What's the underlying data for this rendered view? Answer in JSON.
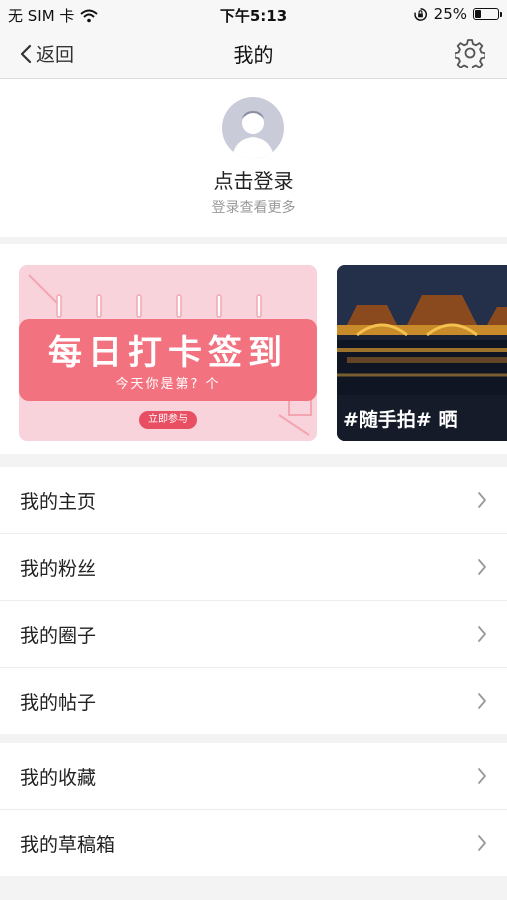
{
  "status_bar": {
    "carrier": "无 SIM 卡",
    "time": "下午5:13",
    "battery_percent": "25%",
    "battery_level": 0.25
  },
  "nav": {
    "back_label": "返回",
    "title": "我的"
  },
  "profile": {
    "login_title": "点击登录",
    "login_subtitle": "登录查看更多"
  },
  "banners": {
    "checkin": {
      "title": "每日打卡签到",
      "subtitle": "今天你是第? 个",
      "button": "立即参与"
    },
    "photo": {
      "caption": "#随手拍# 晒"
    }
  },
  "list_group_1": [
    "我的主页",
    "我的粉丝",
    "我的圈子",
    "我的帖子"
  ],
  "list_group_2": [
    "我的收藏",
    "我的草稿箱"
  ],
  "colors": {
    "checkin_bg": "#f9d3dc",
    "checkin_ribbon": "#f3727f",
    "checkin_button": "#e84f63",
    "avatar_bg": "#c9cbd8"
  },
  "icons": {
    "back": "chevron-left-icon",
    "settings": "gear-icon",
    "wifi": "wifi-icon",
    "rotation_lock": "rotation-lock-icon",
    "battery": "battery-icon",
    "chevron": "chevron-right-icon"
  }
}
